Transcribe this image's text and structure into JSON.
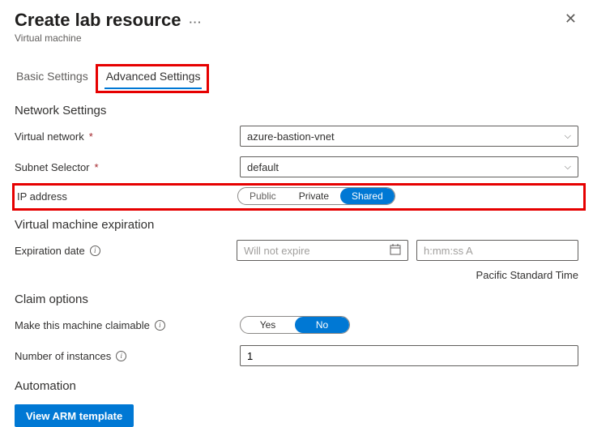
{
  "header": {
    "title": "Create lab resource",
    "subtitle": "Virtual machine"
  },
  "tabs": {
    "basic": "Basic Settings",
    "advanced": "Advanced Settings"
  },
  "network": {
    "section": "Network Settings",
    "virtual_network_label": "Virtual network",
    "virtual_network_value": "azure-bastion-vnet",
    "subnet_label": "Subnet Selector",
    "subnet_value": "default",
    "ip_label": "IP address",
    "ip_options": {
      "public": "Public",
      "private": "Private",
      "shared": "Shared"
    }
  },
  "expiration": {
    "section": "Virtual machine expiration",
    "date_label": "Expiration date",
    "date_placeholder": "Will not expire",
    "time_placeholder": "h:mm:ss A",
    "tz": "Pacific Standard Time"
  },
  "claim": {
    "section": "Claim options",
    "claimable_label": "Make this machine claimable",
    "yes": "Yes",
    "no": "No",
    "instances_label": "Number of instances",
    "instances_value": "1"
  },
  "automation": {
    "section": "Automation",
    "view_template": "View ARM template"
  }
}
